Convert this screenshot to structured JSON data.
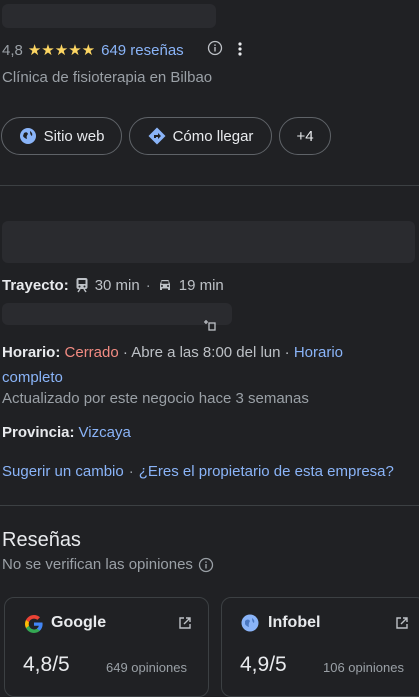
{
  "rating": {
    "score": "4,8",
    "stars": "★★★★★",
    "reviews_link": "649 reseñas",
    "info_icon": "info-icon",
    "more_icon": "more-vert-icon",
    "category": "Clínica de fisioterapia en Bilbao"
  },
  "actions": {
    "website": "Sitio web",
    "directions": "Cómo llegar",
    "more": "+4"
  },
  "commute": {
    "label": "Trayecto:",
    "transit": "30 min",
    "separator": "·",
    "car": "19 min"
  },
  "hours": {
    "label": "Horario:",
    "status": "Cerrado",
    "opens": "· Abre a las 8:00 del lun ·",
    "link_part1": "Horario",
    "link_part2": "completo",
    "updated": "Actualizado por este negocio hace 3 semanas"
  },
  "province": {
    "label": "Provincia:",
    "value": "Vizcaya"
  },
  "suggest": {
    "change": "Sugerir un cambio",
    "sep": "·",
    "owner": "¿Eres el propietario de esta empresa?"
  },
  "reviews": {
    "heading": "Reseñas",
    "note": "No se verifican las opiniones",
    "cards": [
      {
        "source": "Google",
        "score": "4,8/5",
        "count": "649 opiniones"
      },
      {
        "source": "Infobel",
        "score": "4,9/5",
        "count": "106 opiniones"
      }
    ]
  },
  "colors": {
    "background": "#202124",
    "link": "#8ab4f8",
    "closed": "#f28b82",
    "star": "#fdd663"
  }
}
